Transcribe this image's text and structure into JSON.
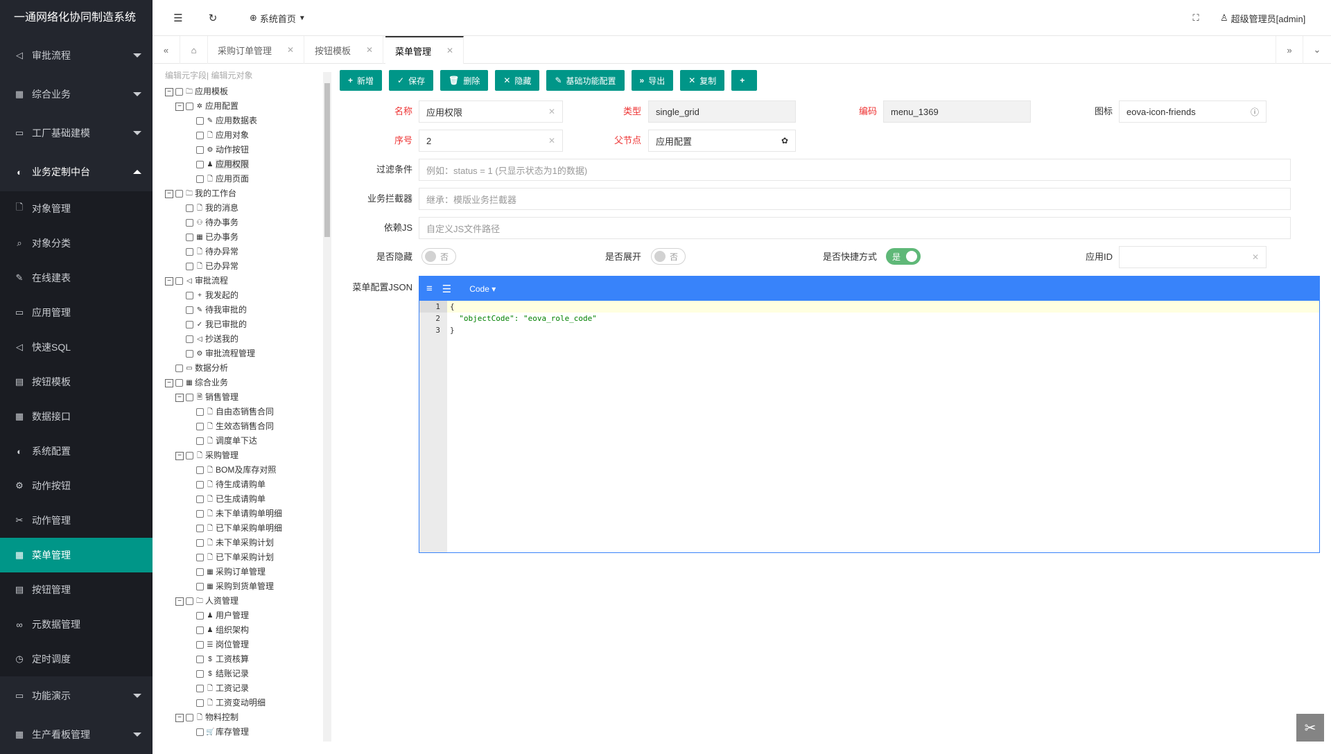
{
  "app": {
    "title": "一通网络化协同制造系统"
  },
  "sidebar": {
    "items": [
      {
        "label": "审批流程",
        "icon": "send-icon",
        "caret": true
      },
      {
        "label": "综合业务",
        "icon": "grid-icon",
        "caret": true
      },
      {
        "label": "工厂基础建模",
        "icon": "folder-icon",
        "caret": true
      },
      {
        "label": "业务定制中台",
        "icon": "compass-icon",
        "caret": true,
        "open": true
      },
      {
        "label": "对象管理",
        "icon": "file-icon"
      },
      {
        "label": "对象分类",
        "icon": "search-icon"
      },
      {
        "label": "在线建表",
        "icon": "edit-icon"
      },
      {
        "label": "应用管理",
        "icon": "folder-icon"
      },
      {
        "label": "快速SQL",
        "icon": "send-icon"
      },
      {
        "label": "按钮模板",
        "icon": "template-icon"
      },
      {
        "label": "数据接口",
        "icon": "table-icon"
      },
      {
        "label": "系统配置",
        "icon": "compass-icon"
      },
      {
        "label": "动作按钮",
        "icon": "gear-icon"
      },
      {
        "label": "动作管理",
        "icon": "tools-icon"
      },
      {
        "label": "菜单管理",
        "icon": "grid-icon",
        "active": true
      },
      {
        "label": "按钮管理",
        "icon": "template-icon"
      },
      {
        "label": "元数据管理",
        "icon": "link-icon"
      },
      {
        "label": "定时调度",
        "icon": "clock-icon"
      },
      {
        "label": "功能演示",
        "icon": "folder-icon",
        "caret": true
      },
      {
        "label": "生产看板管理",
        "icon": "table-icon",
        "caret": true
      }
    ]
  },
  "topbar": {
    "home_label": "系统首页",
    "user_label": "超级管理员[admin]"
  },
  "tabs": [
    {
      "label": "采购订单管理"
    },
    {
      "label": "按钮模板"
    },
    {
      "label": "菜单管理",
      "active": true
    }
  ],
  "tree": {
    "header": "编辑元字段| 编辑元对象",
    "nodes": [
      {
        "label": "应用模板",
        "level": 0,
        "toggle": "−",
        "icon": "🗀"
      },
      {
        "label": "应用配置",
        "level": 1,
        "toggle": "−",
        "icon": "✲"
      },
      {
        "label": "应用数据表",
        "level": 2,
        "icon": "✎"
      },
      {
        "label": "应用对象",
        "level": 2,
        "icon": "🗋"
      },
      {
        "label": "动作按钮",
        "level": 2,
        "icon": "⚙"
      },
      {
        "label": "应用权限",
        "level": 2,
        "icon": "♟",
        "selected": true
      },
      {
        "label": "应用页面",
        "level": 2,
        "icon": "🗋"
      },
      {
        "label": "我的工作台",
        "level": 0,
        "toggle": "−",
        "icon": "🗀"
      },
      {
        "label": "我的消息",
        "level": 1,
        "icon": "🗋"
      },
      {
        "label": "待办事务",
        "level": 1,
        "icon": "⚇"
      },
      {
        "label": "已办事务",
        "level": 1,
        "icon": "▦"
      },
      {
        "label": "待办异常",
        "level": 1,
        "icon": "🗋"
      },
      {
        "label": "已办异常",
        "level": 1,
        "icon": "🗋"
      },
      {
        "label": "审批流程",
        "level": 0,
        "toggle": "−",
        "icon": "◁"
      },
      {
        "label": "我发起的",
        "level": 1,
        "icon": "+"
      },
      {
        "label": "待我审批的",
        "level": 1,
        "icon": "✎"
      },
      {
        "label": "我已审批的",
        "level": 1,
        "icon": "✓"
      },
      {
        "label": "抄送我的",
        "level": 1,
        "icon": "◁"
      },
      {
        "label": "审批流程管理",
        "level": 1,
        "icon": "⚙"
      },
      {
        "label": "数据分析",
        "level": 0,
        "icon": "▭"
      },
      {
        "label": "综合业务",
        "level": 0,
        "toggle": "−",
        "icon": "▦"
      },
      {
        "label": "销售管理",
        "level": 1,
        "toggle": "−",
        "icon": "🗎"
      },
      {
        "label": "自由态销售合同",
        "level": 2,
        "icon": "🗋"
      },
      {
        "label": "生效态销售合同",
        "level": 2,
        "icon": "🗋"
      },
      {
        "label": "调度单下达",
        "level": 2,
        "icon": "🗋"
      },
      {
        "label": "采购管理",
        "level": 1,
        "toggle": "−",
        "icon": "🗋"
      },
      {
        "label": "BOM及库存对照",
        "level": 2,
        "icon": "🗋"
      },
      {
        "label": "待生成请购单",
        "level": 2,
        "icon": "🗋"
      },
      {
        "label": "已生成请购单",
        "level": 2,
        "icon": "🗋"
      },
      {
        "label": "未下单请购单明细",
        "level": 2,
        "icon": "🗋"
      },
      {
        "label": "已下单采购单明细",
        "level": 2,
        "icon": "🗋"
      },
      {
        "label": "未下单采购计划",
        "level": 2,
        "icon": "🗋"
      },
      {
        "label": "已下单采购计划",
        "level": 2,
        "icon": "🗋"
      },
      {
        "label": "采购订单管理",
        "level": 2,
        "icon": "▦"
      },
      {
        "label": "采购到货单管理",
        "level": 2,
        "icon": "▦"
      },
      {
        "label": "人资管理",
        "level": 1,
        "toggle": "−",
        "icon": "🗀"
      },
      {
        "label": "用户管理",
        "level": 2,
        "icon": "♟"
      },
      {
        "label": "组织架构",
        "level": 2,
        "icon": "♟"
      },
      {
        "label": "岗位管理",
        "level": 2,
        "icon": "☰"
      },
      {
        "label": "工资核算",
        "level": 2,
        "icon": "$"
      },
      {
        "label": "结账记录",
        "level": 2,
        "icon": "$"
      },
      {
        "label": "工资记录",
        "level": 2,
        "icon": "🗋"
      },
      {
        "label": "工资变动明细",
        "level": 2,
        "icon": "🗋"
      },
      {
        "label": "物料控制",
        "level": 1,
        "toggle": "−",
        "icon": "🗋"
      },
      {
        "label": "库存管理",
        "level": 2,
        "icon": "🛒"
      }
    ]
  },
  "toolbar": {
    "buttons": [
      {
        "label": "新增",
        "icon": "+"
      },
      {
        "label": "保存",
        "icon": "✓"
      },
      {
        "label": "删除",
        "icon": "🗑"
      },
      {
        "label": "隐藏",
        "icon": "✕"
      },
      {
        "label": "基础功能配置",
        "icon": "✎"
      },
      {
        "label": "导出",
        "icon": "»"
      },
      {
        "label": "复制",
        "icon": "✕"
      },
      {
        "label": "",
        "icon": "+"
      }
    ]
  },
  "form": {
    "name_label": "名称",
    "name_value": "应用权限",
    "type_label": "类型",
    "type_value": "single_grid",
    "code_label": "编码",
    "code_value": "menu_1369",
    "icon_label": "图标",
    "icon_value": "eova-icon-friends",
    "order_label": "序号",
    "order_value": "2",
    "parent_label": "父节点",
    "parent_value": "应用配置",
    "filter_label": "过滤条件",
    "filter_placeholder": "例如：status = 1 (只显示状态为1的数据)",
    "interceptor_label": "业务拦截器",
    "interceptor_placeholder": "继承：模版业务拦截器",
    "js_label": "依赖JS",
    "js_placeholder": "自定义JS文件路径",
    "hidden_label": "是否隐藏",
    "hidden_value": "否",
    "expand_label": "是否展开",
    "expand_value": "否",
    "shortcut_label": "是否快捷方式",
    "shortcut_value": "是",
    "appid_label": "应用ID",
    "appid_value": "",
    "json_label": "菜单配置JSON"
  },
  "editor": {
    "mode_label": "Code ▾",
    "lines": [
      "1",
      "2",
      "3"
    ],
    "code": [
      "{",
      "  \"objectCode\": \"eova_role_code\"",
      "}"
    ]
  }
}
